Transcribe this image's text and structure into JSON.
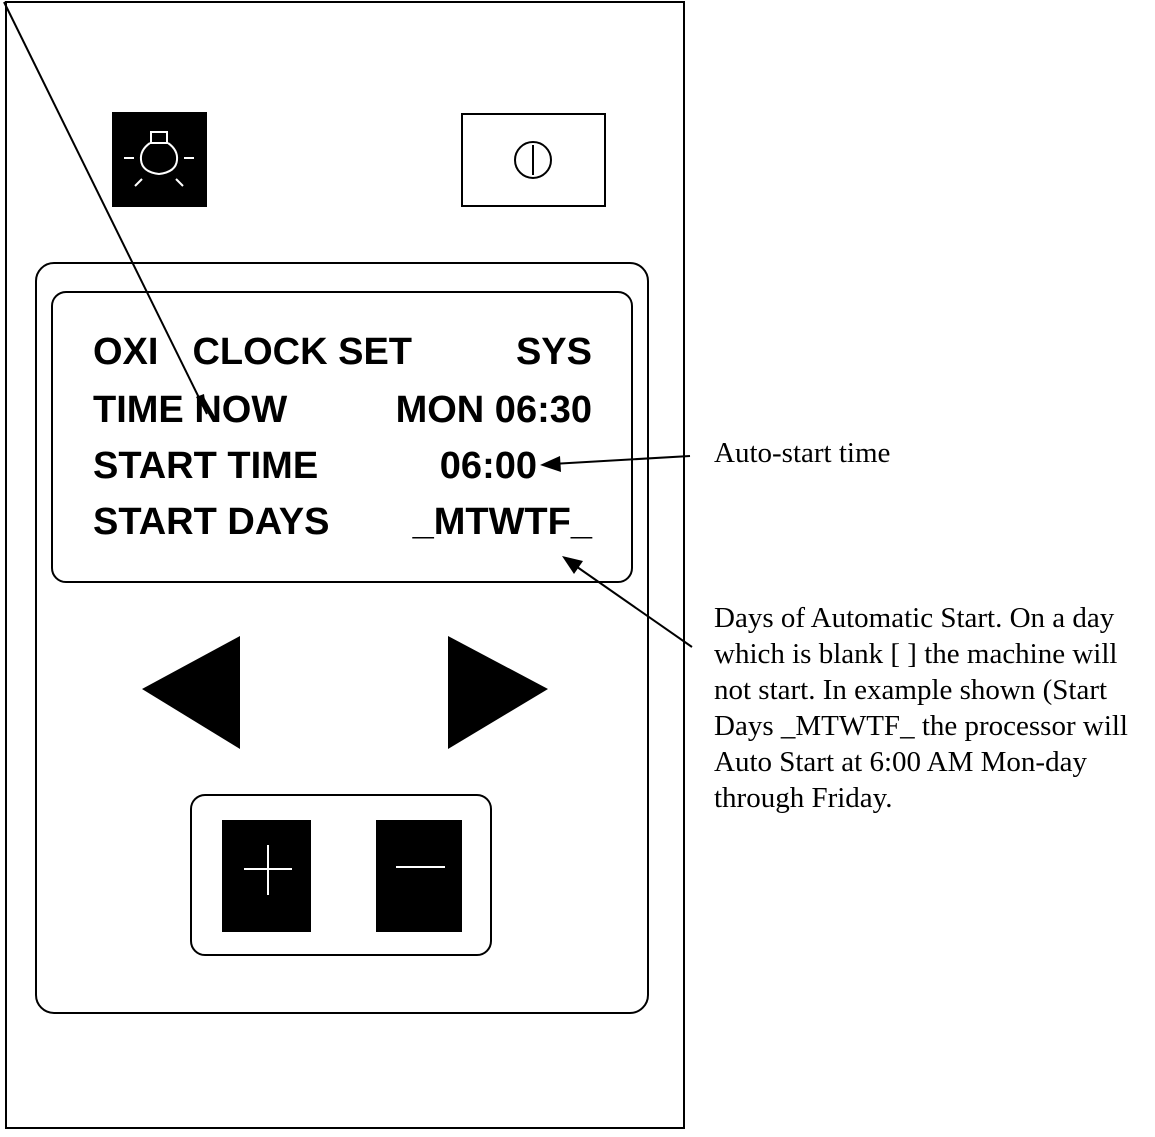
{
  "display": {
    "line1": {
      "left": "OXI",
      "middle": "CLOCK SET",
      "right": "SYS"
    },
    "line2": {
      "left": "TIME NOW",
      "right": "MON 06:30"
    },
    "line3": {
      "left": "START TIME",
      "right": "06:00"
    },
    "line4": {
      "left": "START DAYS",
      "right": "_MTWTF_"
    }
  },
  "buttons": {
    "light": {
      "icon": "lightbulb-icon"
    },
    "power": {
      "icon": "power-icon"
    },
    "left": {
      "icon": "left-arrow-icon"
    },
    "right": {
      "icon": "right-arrow-icon"
    },
    "plus": {
      "icon": "plus-icon"
    },
    "minus": {
      "icon": "minus-icon"
    }
  },
  "annotations": {
    "auto_start_time": "Auto-start time",
    "days_description": "Days of Automatic Start. On a day which is blank [ ] the machine will not start. In example shown (Start Days _MTWTF_ the processor will Auto Start at 6:00 AM Mon-day through Friday."
  }
}
